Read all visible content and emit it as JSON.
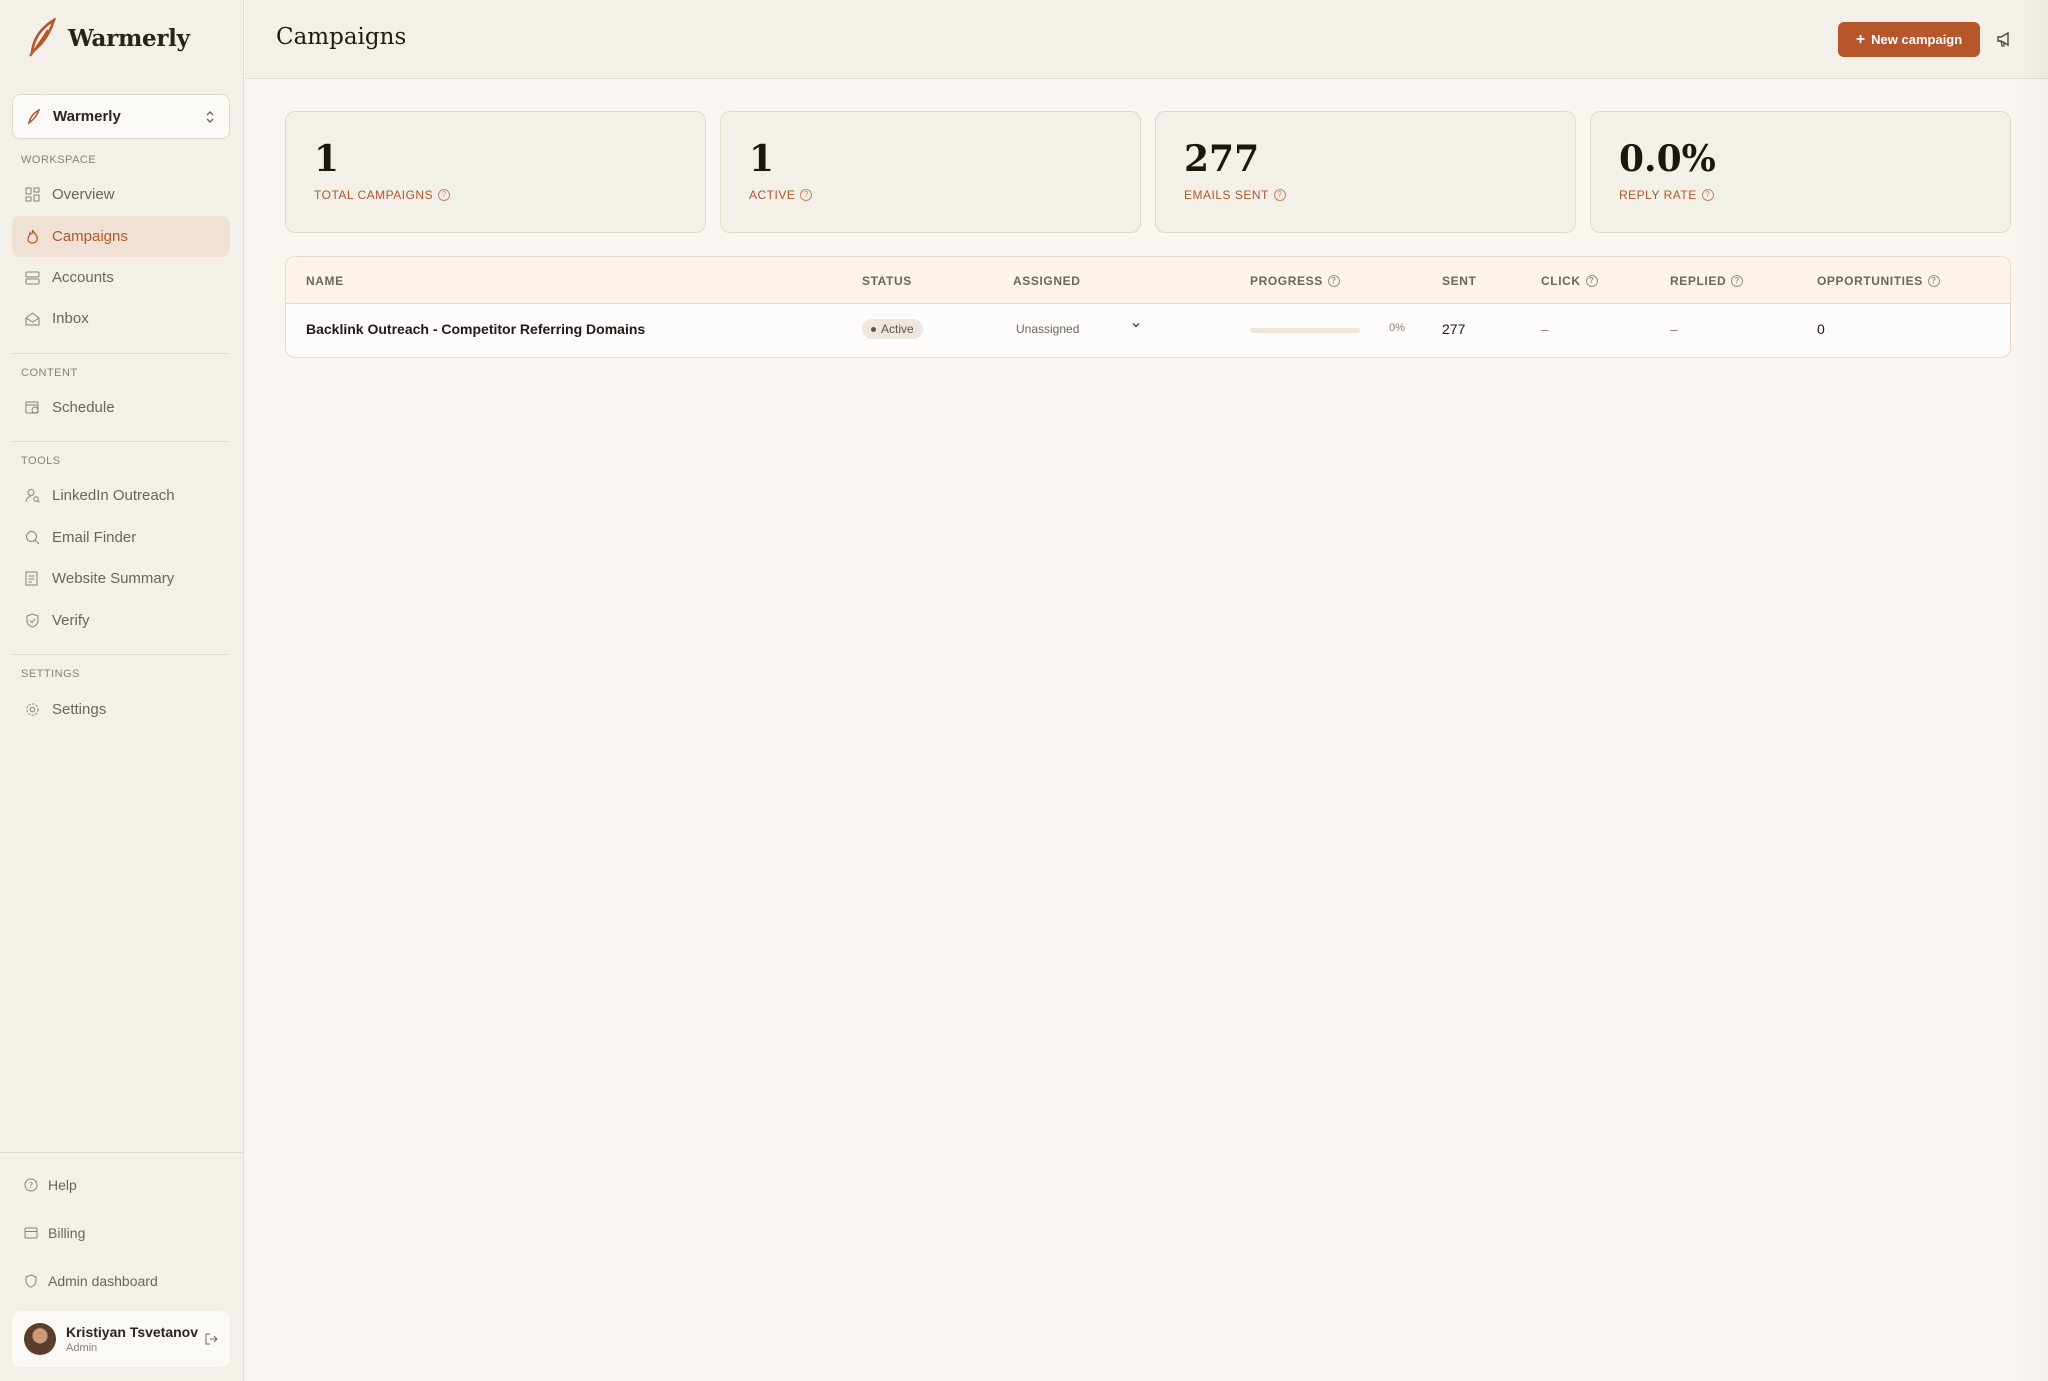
{
  "sidebar": {
    "brand": "Warmerly",
    "workspace_selector": "Warmerly",
    "sections": {
      "workspace": "WORKSPACE",
      "content": "CONTENT",
      "tools": "TOOLS",
      "settings": "SETTINGS"
    },
    "items": {
      "overview": "Overview",
      "campaigns": "Campaigns",
      "accounts": "Accounts",
      "inbox": "Inbox",
      "schedule": "Schedule",
      "linkedin": "LinkedIn Outreach",
      "email_finder": "Email Finder",
      "website_summary": "Website Summary",
      "verify": "Verify",
      "settings": "Settings"
    },
    "footer": {
      "help": "Help",
      "billing": "Billing",
      "admin": "Admin dashboard"
    },
    "user": {
      "name": "Kristiyan Tsvetanov",
      "role": "Admin"
    }
  },
  "header": {
    "title": "Campaigns",
    "new_button": "New campaign"
  },
  "stats": [
    {
      "value": "1",
      "label": "TOTAL CAMPAIGNS"
    },
    {
      "value": "1",
      "label": "ACTIVE"
    },
    {
      "value": "277",
      "label": "EMAILS SENT"
    },
    {
      "value": "0.0%",
      "label": "REPLY RATE"
    }
  ],
  "table": {
    "headers": {
      "name": "NAME",
      "status": "STATUS",
      "assigned": "ASSIGNED",
      "progress": "PROGRESS",
      "sent": "SENT",
      "click": "CLICK",
      "replied": "REPLIED",
      "opportunities": "OPPORTUNITIES"
    },
    "rows": [
      {
        "name": "Backlink Outreach - Competitor Referring Domains",
        "status": "Active",
        "assigned": "Unassigned",
        "progress": 0,
        "progress_label": "0%",
        "sent": "277",
        "click": "–",
        "replied": "–",
        "opportunities": "0"
      }
    ]
  },
  "colors": {
    "accent": "#b5562b",
    "sidebar_bg": "#f3efe9",
    "page_bg": "#f9f6f1"
  }
}
